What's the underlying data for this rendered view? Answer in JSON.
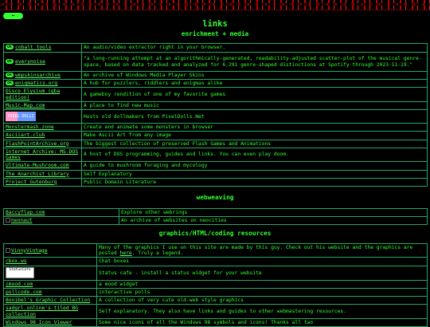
{
  "page": {
    "back_label": "←",
    "title": "links"
  },
  "sections": [
    {
      "heading": "enrichment + media",
      "rows": [
        {
          "badge": "ok",
          "link": "cobalt tools",
          "desc": "An audio/video extractor right in your browser."
        },
        {
          "badge": "ok",
          "link": "everynoise",
          "desc": "\"a long-running attempt at an algorithmically-generated, readability-adjusted scatter-plot of the musical genre-space, based on data tracked and analyzed for 6,291 genre-shaped distinctions at Spotify through 2023-11-19.\""
        },
        {
          "badge": "ok",
          "link": "wmpskinsarchive",
          "desc": "An archive of Windows Media Player Skins"
        },
        {
          "badge": "ok",
          "link": "enigmatics.org",
          "desc": "A hub for puzzlers, riddlers and enigmas alike"
        },
        {
          "badge": "",
          "link": "Disco Elysium (gba edition)",
          "desc": "A gameboy rendition of one of my favorite games"
        },
        {
          "badge": "",
          "link": "Music-Map.com",
          "desc": "A place to find new music"
        },
        {
          "badge": "",
          "link": "Pixel Dollz",
          "desc": "Hosts old dollmakers from PixelDolls.Net",
          "image": "pixel-dollz-banner"
        },
        {
          "badge": "",
          "link": "Monstermash.zone",
          "desc": "Create and animate some monsters in browser"
        },
        {
          "badge": "",
          "link": "Asciiart.club",
          "desc": "Make Ascii Art from any image"
        },
        {
          "badge": "",
          "link": "FlashPointArchive.org",
          "desc": "The biggest collection of preserved Flash Games and Animations"
        },
        {
          "badge": "",
          "link": "Internet Archive: MS-DOS Games",
          "desc": "A host of DOS programming, guides and links. You can even play doom."
        },
        {
          "badge": "",
          "link": "Ultimate-Mushroom.com",
          "desc": "A guide to mushroom foraging and mycology"
        },
        {
          "badge": "",
          "link": "The Anarchist Library",
          "desc": "Self Explanatory"
        },
        {
          "badge": "",
          "link": "Project Gutenburg",
          "desc": "Public Domain Literature"
        }
      ]
    },
    {
      "heading": "webweaving",
      "rows": [
        {
          "link": "Baccyflap.com",
          "desc": "Explore other webrings"
        },
        {
          "link": "neonaut",
          "desc": "An archive of websites on neocities",
          "broken_image": true
        }
      ]
    },
    {
      "heading": "graphics/HTML/coding resources",
      "rows": [
        {
          "link": "VinnyVintage",
          "desc": "Many of the graphics I use on this site are made by this guy. Check out his website and the graphics are posted ",
          "desc_link": "here",
          "desc_tail": ". Truly a legend.",
          "broken_image": true
        },
        {
          "link": "cbox.ws",
          "desc": "Chat boxes"
        },
        {
          "link": "Status Cafe",
          "desc": "Status cafe - install a status widget for your website",
          "image": "status-cafe-banner"
        },
        {
          "link": "imood.com",
          "desc": "a mood widget"
        },
        {
          "link": "pollcode.com",
          "desc": "interactive polls"
        },
        {
          "link": "Bonibel's Graphic Collection",
          "desc": "A collection of very cute old-web style graphics"
        },
        {
          "link": "sadgrl.online's tiled BG collection",
          "desc": "Self explanatory. They also have links and guides to other webmastering resources."
        },
        {
          "link": "Windows 98 Icon Viewer",
          "desc": "Some nice icons of all the Windows 98 symbols and icons! Thanks all two"
        }
      ]
    }
  ],
  "images": {
    "pixel_dollz_text": "PIXEL DOLLZ",
    "status_cafe_text": "StatusCafe"
  },
  "colors": {
    "background": "#000000",
    "text": "#33ff33",
    "border": "#22aa66"
  }
}
